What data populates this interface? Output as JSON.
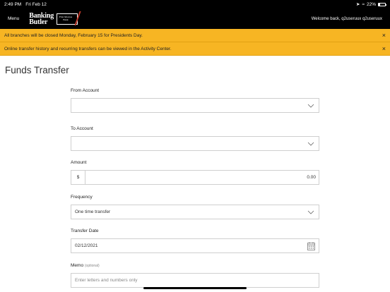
{
  "status_bar": {
    "time": "2:49 PM",
    "date": "Fri Feb 12",
    "battery": "22%",
    "battery_level": 0.22
  },
  "header": {
    "menu_label": "Menu",
    "logo_line1": "Banking",
    "logo_line2": "Butler",
    "seal_text": "First Monroe Bank",
    "welcome": "Welcome back, q2useruux q2useruux"
  },
  "banners": [
    {
      "text": "All branches will be closed Monday, February 15 for Presidents Day.",
      "close": "×"
    },
    {
      "text": "Online transfer history and recurring transfers can be viewed in the Activity Center.",
      "close": "×"
    }
  ],
  "page": {
    "title": "Funds Transfer"
  },
  "form": {
    "from_account": {
      "label": "From Account",
      "value": ""
    },
    "to_account": {
      "label": "To Account",
      "value": ""
    },
    "amount": {
      "label": "Amount",
      "prefix": "$",
      "value": "0.00"
    },
    "frequency": {
      "label": "Frequency",
      "value": "One time transfer"
    },
    "transfer_date": {
      "label": "Transfer Date",
      "value": "02/12/2021"
    },
    "memo": {
      "label": "Memo",
      "optional": "(optional)",
      "placeholder": "Enter letters and numbers only"
    }
  }
}
